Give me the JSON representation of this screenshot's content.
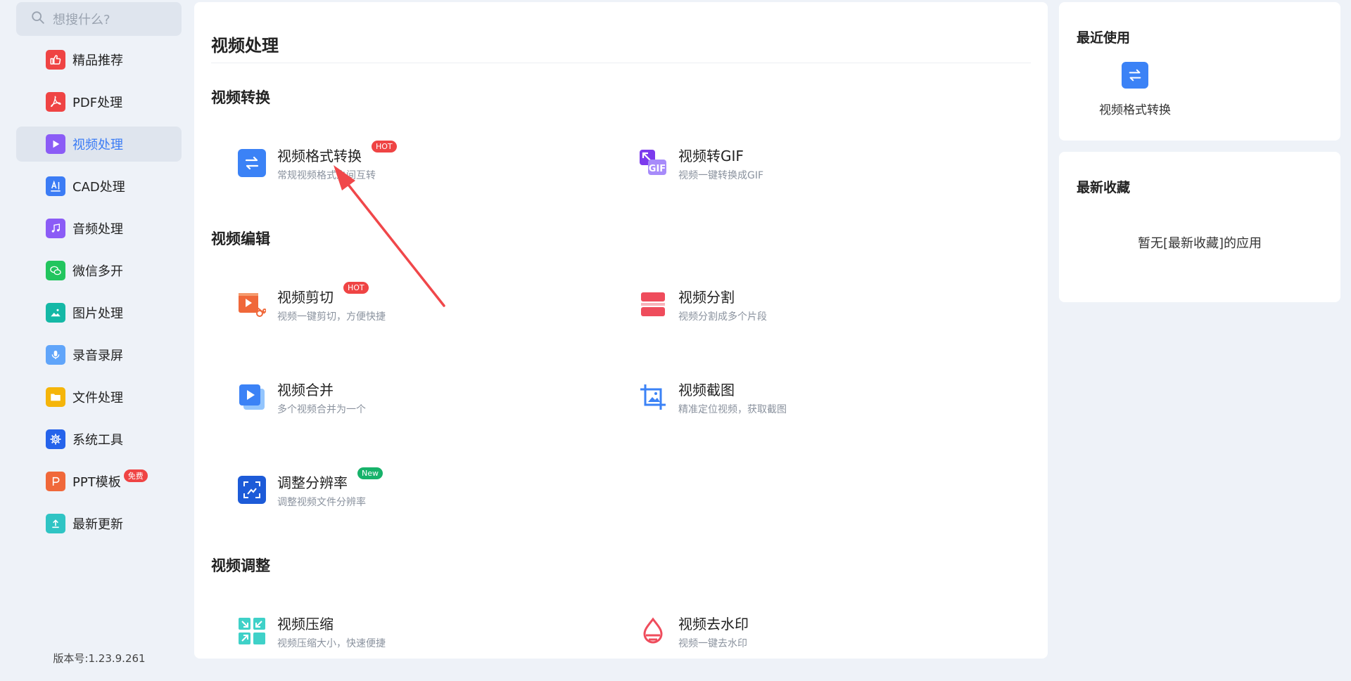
{
  "search": {
    "placeholder": "想搜什么?"
  },
  "sidebar": {
    "items": [
      {
        "label": "精品推荐",
        "icon": "thumbs-up-icon",
        "color": "#ef4444"
      },
      {
        "label": "PDF处理",
        "icon": "pdf-icon",
        "color": "#ef4444"
      },
      {
        "label": "视频处理",
        "icon": "video-play-icon",
        "color": "#8b5cf6",
        "active": true
      },
      {
        "label": "CAD处理",
        "icon": "cad-icon",
        "color": "#3b7cf5"
      },
      {
        "label": "音频处理",
        "icon": "music-icon",
        "color": "#8b5cf6"
      },
      {
        "label": "微信多开",
        "icon": "wechat-icon",
        "color": "#22c55e"
      },
      {
        "label": "图片处理",
        "icon": "image-icon",
        "color": "#14b8a6"
      },
      {
        "label": "录音录屏",
        "icon": "microphone-icon",
        "color": "#60a5fa"
      },
      {
        "label": "文件处理",
        "icon": "folder-icon",
        "color": "#f5b50a"
      },
      {
        "label": "系统工具",
        "icon": "gear-icon",
        "color": "#2563eb"
      },
      {
        "label": "PPT模板",
        "icon": "ppt-icon",
        "color": "#f0683a",
        "badge": "免费"
      },
      {
        "label": "最新更新",
        "icon": "upload-icon",
        "color": "#2fc4c4"
      }
    ],
    "version": "版本号:1.23.9.261"
  },
  "main": {
    "title": "视频处理",
    "sections": [
      {
        "title": "视频转换"
      },
      {
        "title": "视频编辑"
      },
      {
        "title": "视频调整"
      }
    ],
    "tools": [
      {
        "name": "视频格式转换",
        "desc": "常规视频格式之间互转",
        "tag": "HOT",
        "icon": "convert-arrows-icon"
      },
      {
        "name": "视频转GIF",
        "desc": "视频一键转换成GIF",
        "icon": "gif-icon"
      },
      {
        "name": "视频剪切",
        "desc": "视频一键剪切，方便快捷",
        "tag": "HOT",
        "icon": "video-cut-icon"
      },
      {
        "name": "视频分割",
        "desc": "视频分割成多个片段",
        "icon": "split-icon"
      },
      {
        "name": "视频合并",
        "desc": "多个视频合并为一个",
        "icon": "merge-icon"
      },
      {
        "name": "视频截图",
        "desc": "精准定位视频，获取截图",
        "icon": "crop-screenshot-icon"
      },
      {
        "name": "调整分辨率",
        "desc": "调整视频文件分辨率",
        "tag": "New",
        "icon": "resolution-icon"
      },
      {
        "name": "视频压缩",
        "desc": "视频压缩大小，快速便捷",
        "icon": "compress-icon"
      },
      {
        "name": "视频去水印",
        "desc": "视频一键去水印",
        "icon": "watermark-icon"
      }
    ]
  },
  "recent": {
    "title": "最近使用",
    "items": [
      {
        "label": "视频格式转换",
        "icon": "convert-arrows-icon"
      }
    ]
  },
  "favorites": {
    "title": "最新收藏",
    "empty": "暂无[最新收藏]的应用"
  },
  "colors": {
    "accent": "#3b7cf5",
    "hot": "#ef4444",
    "new": "#17b26a",
    "annotation_arrow": "#f0474a"
  }
}
